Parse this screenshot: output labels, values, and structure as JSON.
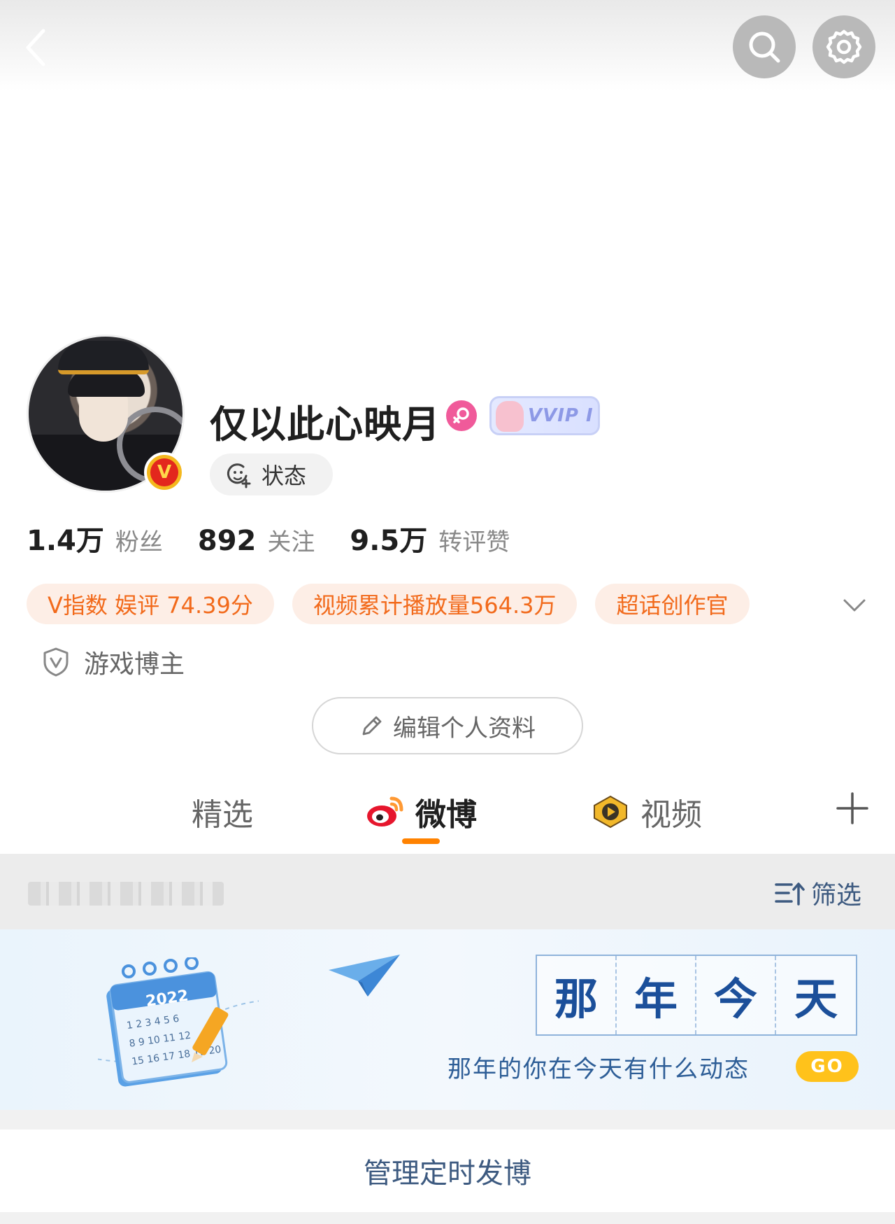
{
  "header": {
    "back_icon": "chevron-left-icon",
    "search_icon": "search-icon",
    "settings_icon": "gear-icon"
  },
  "profile": {
    "username": "仅以此心映月",
    "gender_icon": "female-icon",
    "vip_badge": "VVIP I",
    "status_label": "状态"
  },
  "stats": [
    {
      "value": "1.4万",
      "label": "粉丝"
    },
    {
      "value": "892",
      "label": "关注"
    },
    {
      "value": "9.5万",
      "label": "转评赞"
    }
  ],
  "tags": [
    "V指数 娱评 74.39分",
    "视频累计播放量564.3万",
    "超话创作官"
  ],
  "category": "游戏博主",
  "edit_profile": "编辑个人资料",
  "tabs": [
    {
      "label": "精选",
      "active": false
    },
    {
      "label": "微博",
      "active": true
    },
    {
      "label": "视频",
      "active": false
    }
  ],
  "filter": {
    "label": "筛选"
  },
  "banner": {
    "calendar_year": "2022",
    "title_chars": [
      "那",
      "年",
      "今",
      "天"
    ],
    "subtitle": "那年的你在今天有什么动态",
    "go_label": "GO"
  },
  "manage_label": "管理定时发博",
  "colors": {
    "accent_orange": "#ff8200",
    "tag_text": "#f26a1b",
    "tag_bg": "#fdeee6",
    "link_blue": "#3d5a80"
  }
}
